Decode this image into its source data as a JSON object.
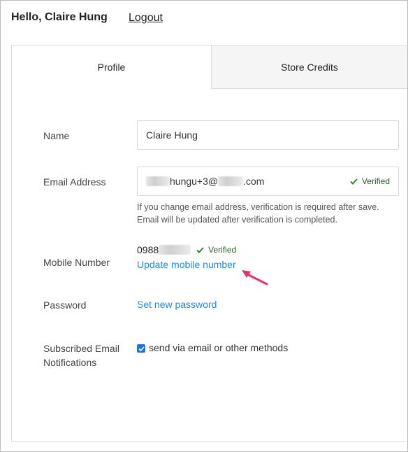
{
  "header": {
    "greeting": "Hello, Claire Hung",
    "logout_label": "Logout"
  },
  "tabs": [
    {
      "label": "Profile",
      "active": true
    },
    {
      "label": "Store Credits",
      "active": false
    }
  ],
  "form": {
    "name": {
      "label": "Name",
      "value": "Claire Hung"
    },
    "email": {
      "label": "Email Address",
      "value_visible": "hungu+3@",
      "value_suffix": ".com",
      "status": "Verified",
      "hint_line1": "If you change email address, verification is required after save.",
      "hint_line2": "Email will be updated after verification is completed."
    },
    "mobile": {
      "label": "Mobile Number",
      "value_prefix": "0988",
      "status": "Verified",
      "update_link": "Update mobile number"
    },
    "password": {
      "label": "Password",
      "link": "Set new password"
    },
    "subscription": {
      "label_line1": "Subscribed Email",
      "label_line2": "Notifications",
      "checkbox_label": "send via email or other methods",
      "checked": true
    }
  },
  "colors": {
    "link": "#1e8be0",
    "verified": "#2a5d2a",
    "arrow": "#e8306a",
    "checkbox": "#1a73e8"
  }
}
